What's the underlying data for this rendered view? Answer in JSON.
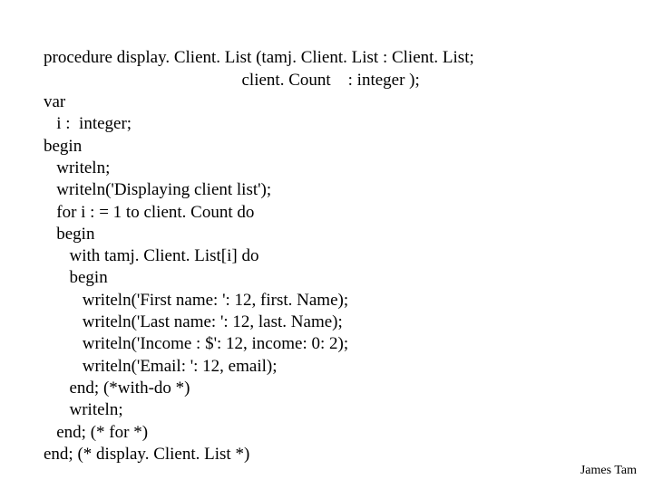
{
  "code": {
    "l01": "procedure display. Client. List (tamj. Client. List : Client. List;",
    "l02": "                                              client. Count    : integer );",
    "l03": "var",
    "l04": "   i :  integer;",
    "l05": "begin",
    "l06": "   writeln;",
    "l07": "   writeln('Displaying client list');",
    "l08": "   for i : = 1 to client. Count do",
    "l09": "   begin",
    "l10": "      with tamj. Client. List[i] do",
    "l11": "      begin",
    "l12": "         writeln('First name: ': 12, first. Name);",
    "l13": "         writeln('Last name: ': 12, last. Name);",
    "l14": "         writeln('Income : $': 12, income: 0: 2);",
    "l15": "         writeln('Email: ': 12, email);",
    "l16": "      end; (*with-do *)",
    "l17": "      writeln;",
    "l18": "   end; (* for *)",
    "l19": "end; (* display. Client. List *)"
  },
  "footer": "James Tam"
}
